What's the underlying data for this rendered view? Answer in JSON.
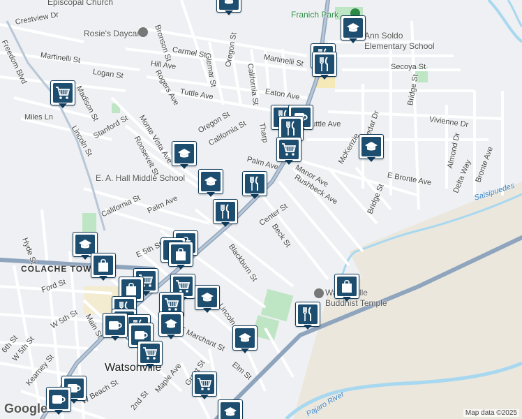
{
  "map": {
    "streets": [
      "Crestview Dr",
      "Martinelli St",
      "Logan St",
      "Madison St",
      "Miles Ln",
      "Freedom Blvd",
      "Lincoln St",
      "Stanford St",
      "Monte Vista Ave",
      "Roosevelt St",
      "Rogers Ave",
      "Hill Ave",
      "Carmel St",
      "Bronson St",
      "Glemar St",
      "Oregon St",
      "California St",
      "Tuttle Ave",
      "Eaton Ave",
      "Martinelli St",
      "Oregon St",
      "California St",
      "Palm Ave",
      "Tharp",
      "Manor Ave",
      "Rushbeck Ave",
      "McKenzie",
      "Cedar Dr",
      "Bridge St",
      "Secoya St",
      "Vivienne Dr",
      "Almond Dr",
      "E Bronte Ave",
      "Delta Way",
      "Bronte Ave",
      "Bridge St",
      "Center St",
      "Beck St",
      "Blackburn St",
      "Palm Ave",
      "California St",
      "Hyde St",
      "Ford St",
      "E 5th St",
      "W 5th St",
      "6th St",
      "W 5th St",
      "Kearney St",
      "W Beach St",
      "2nd St",
      "Maple Ave",
      "Grant St",
      "E Marchant St",
      "Lincoln St",
      "Elm St",
      "Main St",
      "Tuttle Ave"
    ],
    "places": {
      "church": "Episcopal Church",
      "daycare": "Rosie's Daycare",
      "park": "Franich Park",
      "school1": "Ann Soldo\nElementary School",
      "school2": "E. A. Hall Middle School",
      "temple": "Watsonville\nBuddhist Temple",
      "town": "COLACHE TOWN",
      "city": "Watsonville",
      "river1": "Salsipuedes",
      "river2": "Pajaro River"
    },
    "credit": "Map data ©2025",
    "logo": "Google"
  },
  "colors": {
    "marker": "#1d4e6f",
    "road_major": "#8fa4bd",
    "water": "#a8d8f0",
    "park": "#bfe6c4"
  }
}
